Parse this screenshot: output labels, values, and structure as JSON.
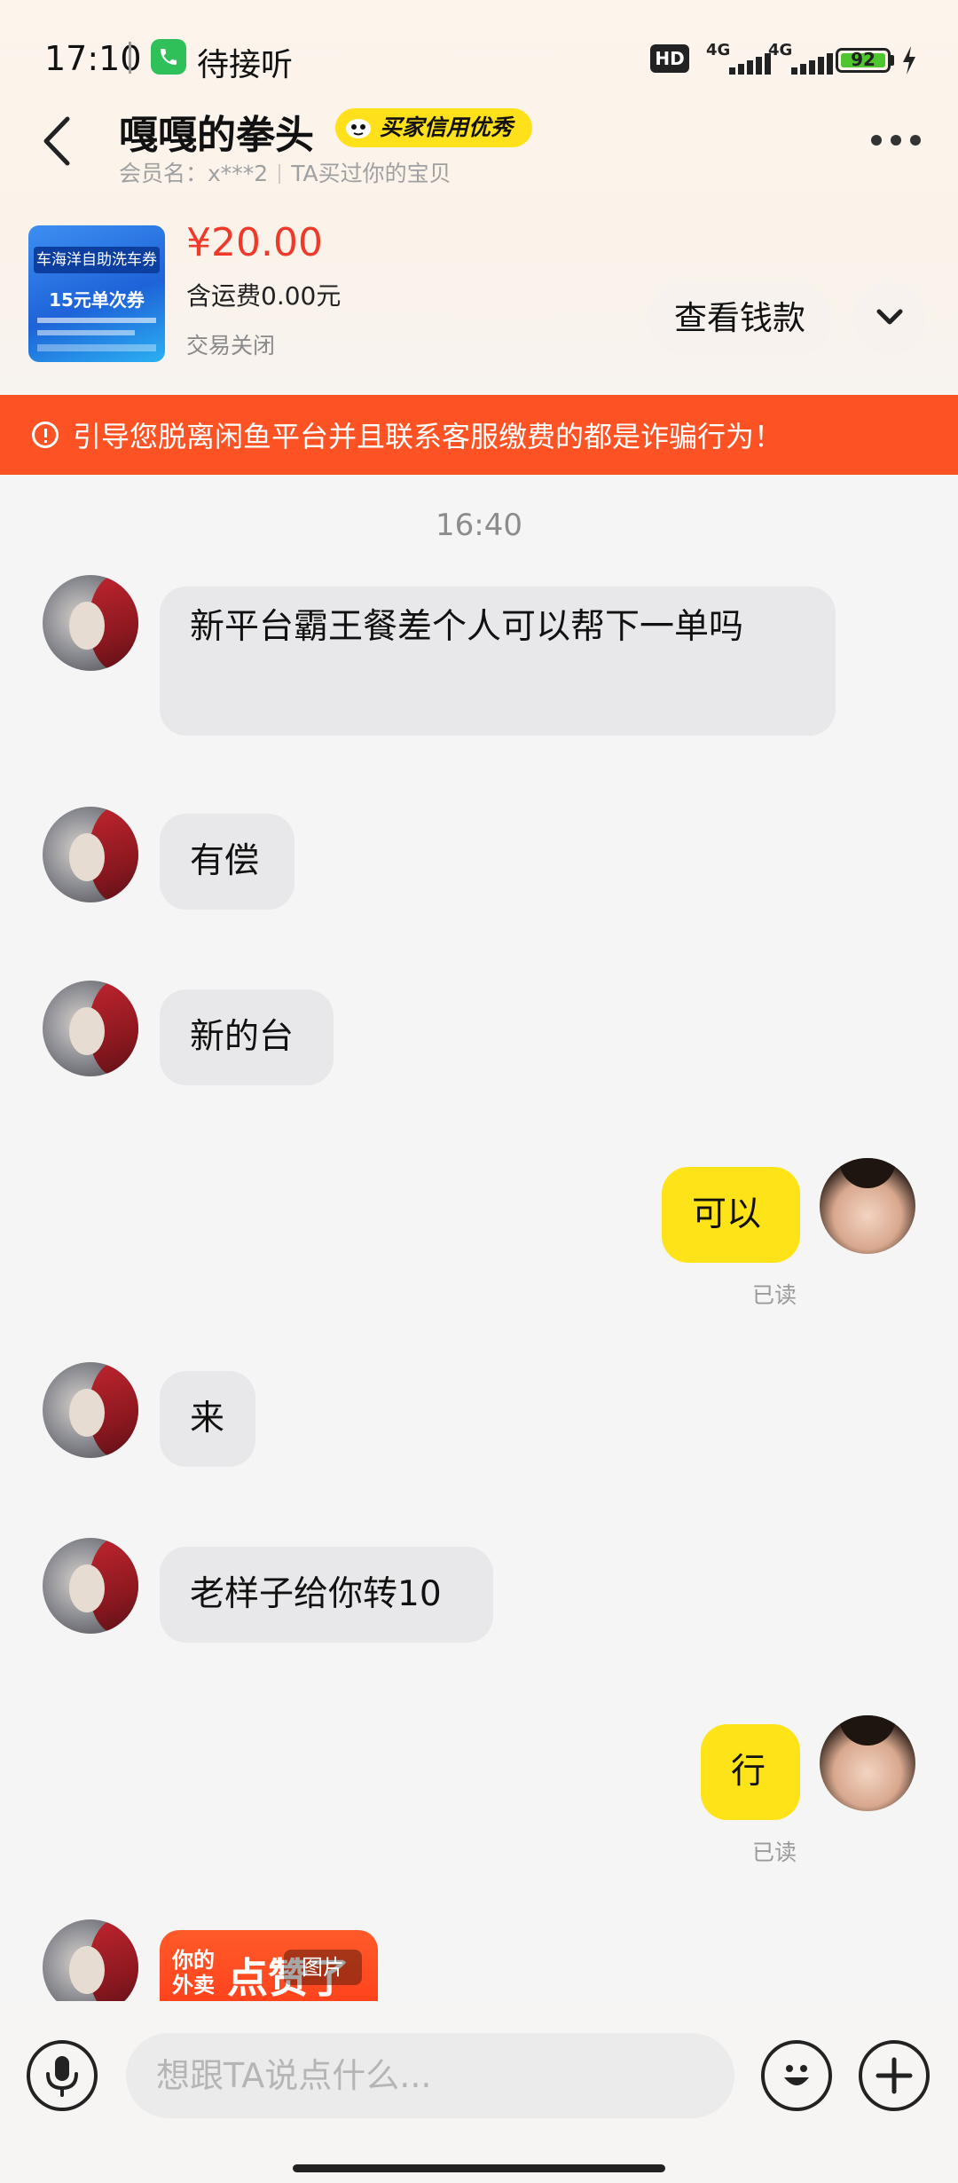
{
  "status_bar": {
    "time": "17:10",
    "call_text": "待接听",
    "hd": "HD",
    "network1": "4G",
    "network2": "4G",
    "battery": "92"
  },
  "header": {
    "title": "嘎嘎的拳头",
    "badge": "买家信用优秀",
    "member_label": "会员名：x***2",
    "member_note": "TA买过你的宝贝"
  },
  "product": {
    "thumb_line1": "车海洋自助洗车券",
    "thumb_line2": "15元单次券",
    "price": "¥20.00",
    "shipping": "含运费0.00元",
    "status": "交易关闭",
    "view_payment_label": "查看钱款"
  },
  "warning": {
    "text": "引导您脱离闲鱼平台并且联系客服缴费的都是诈骗行为！"
  },
  "chat": {
    "time_divider": "16:40",
    "messages": [
      {
        "sender": "other",
        "text": "新平台霸王餐差个人可以帮下一单吗"
      },
      {
        "sender": "other",
        "text": "有偿"
      },
      {
        "sender": "other",
        "text": "新的台"
      },
      {
        "sender": "self",
        "text": "可以",
        "status": "已读"
      },
      {
        "sender": "other",
        "text": "来"
      },
      {
        "sender": "other",
        "text": "老样子给你转10"
      },
      {
        "sender": "self",
        "text": "行",
        "status": "已读"
      }
    ],
    "image_message": {
      "label_a": "你的外卖",
      "label_b": "点赞了",
      "tag": "图片"
    }
  },
  "input": {
    "placeholder": "想跟TA说点什么..."
  },
  "colors": {
    "accent_yellow": "#ffe319",
    "price_red": "#ee3a2b",
    "warning_orange": "#fc5224",
    "bubble_other": "#e8e8ea"
  }
}
